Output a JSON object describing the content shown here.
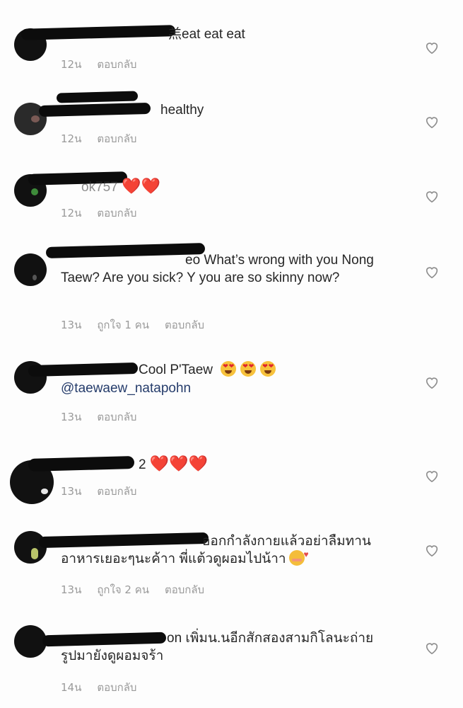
{
  "comments": [
    {
      "text": "羔eat eat eat",
      "time": "12น",
      "likes": "",
      "reply": "ตอบกลับ"
    },
    {
      "text": "healthy",
      "time": "12น",
      "likes": "",
      "reply": "ตอบกลับ"
    },
    {
      "text": "ok757",
      "time": "12น",
      "likes": "",
      "reply": "ตอบกลับ"
    },
    {
      "text": "eo What’s wrong with you Nong Taew? Are you sick? Y you are so skinny now?",
      "time": "13น",
      "likes": "ถูกใจ 1 คน",
      "reply": "ตอบกลับ"
    },
    {
      "text": "Cool P'Taew",
      "mention": "@taewaew_natapohn",
      "time": "13น",
      "likes": "",
      "reply": "ตอบกลับ"
    },
    {
      "text": "2",
      "time": "13น",
      "likes": "",
      "reply": "ตอบกลับ"
    },
    {
      "text": "ออกกำลังกายแล้วอย่าลืมทานอาหารเยอะๆนะค้าา พี่แต้วดูผอมไปน้าา",
      "time": "13น",
      "likes": "ถูกใจ 2 คน",
      "reply": "ตอบกลับ"
    },
    {
      "text": "on เพิ่มน.นอีกสักสองสามกิโลนะถ่ายรูปมายังดูผอมจร้า",
      "time": "14น",
      "likes": "",
      "reply": "ตอบกลับ"
    }
  ],
  "icons": {
    "like": "heart-outline-icon",
    "hearts": "red-heart-emoji",
    "heart_eyes": "heart-eyes-emoji",
    "blush": "smiling-face-with-hearts-emoji"
  },
  "colors": {
    "text": "#262626",
    "meta": "#9a9a9a",
    "mention": "#253c6b",
    "heart": "#e02424"
  }
}
